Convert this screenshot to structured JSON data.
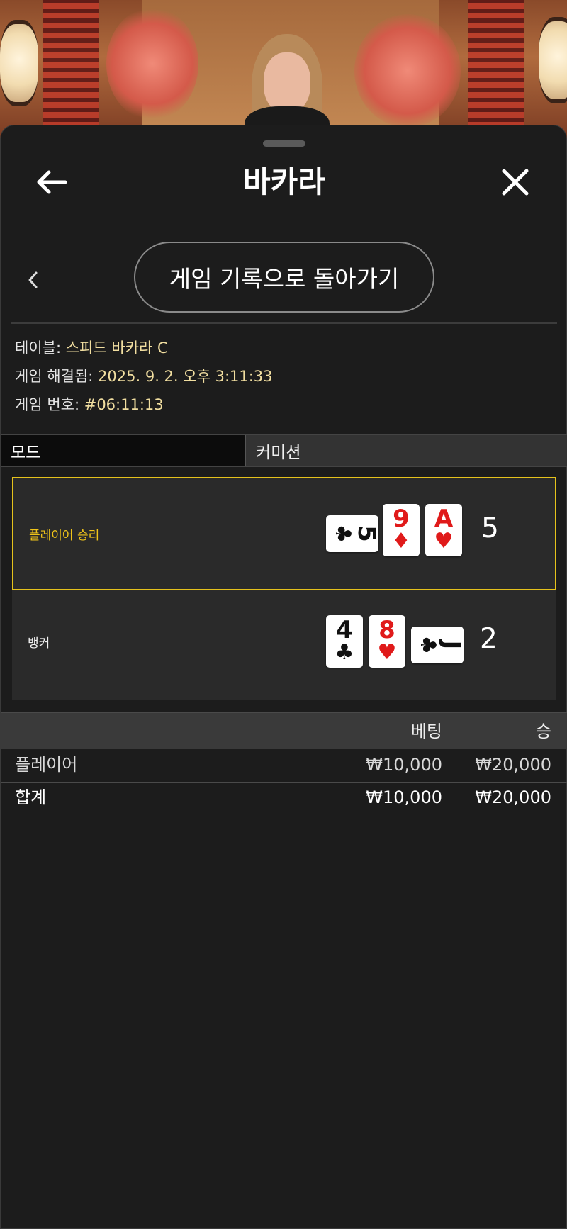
{
  "header": {
    "title": "바카라"
  },
  "nav": {
    "return_label": "게임 기록으로 돌아가기"
  },
  "info": {
    "table_label": "테이블:",
    "table_value": "스피드 바카라 C",
    "resolved_label": "게임 해결됨:",
    "resolved_value": "2025. 9. 2. 오후 3:11:33",
    "number_label": "게임 번호:",
    "number_value": "#06:11:13"
  },
  "tabs": {
    "mode": "모드",
    "commission": "커미션"
  },
  "results": {
    "player": {
      "label": "플레이어 승리",
      "score": "5",
      "cards": [
        {
          "rank": "5",
          "suit": "♣",
          "color": "black",
          "orientation": "sideways"
        },
        {
          "rank": "9",
          "suit": "♦",
          "color": "red",
          "orientation": "upright"
        },
        {
          "rank": "A",
          "suit": "♥",
          "color": "red",
          "orientation": "upright"
        }
      ]
    },
    "banker": {
      "label": "뱅커",
      "score": "2",
      "cards": [
        {
          "rank": "4",
          "suit": "♣",
          "color": "black",
          "orientation": "upright"
        },
        {
          "rank": "8",
          "suit": "♥",
          "color": "red",
          "orientation": "upright"
        },
        {
          "rank": "J",
          "suit": "♣",
          "color": "black",
          "orientation": "sideways"
        }
      ]
    }
  },
  "bets": {
    "col_bet": "베팅",
    "col_win": "승",
    "rows": [
      {
        "label": "플레이어",
        "bet": "₩10,000",
        "win": "₩20,000"
      },
      {
        "label": "합계",
        "bet": "₩10,000",
        "win": "₩20,000"
      }
    ]
  },
  "colors": {
    "accent_gold": "#e5c21c",
    "value_text": "#f1dea0",
    "card_red": "#e01a1a"
  }
}
